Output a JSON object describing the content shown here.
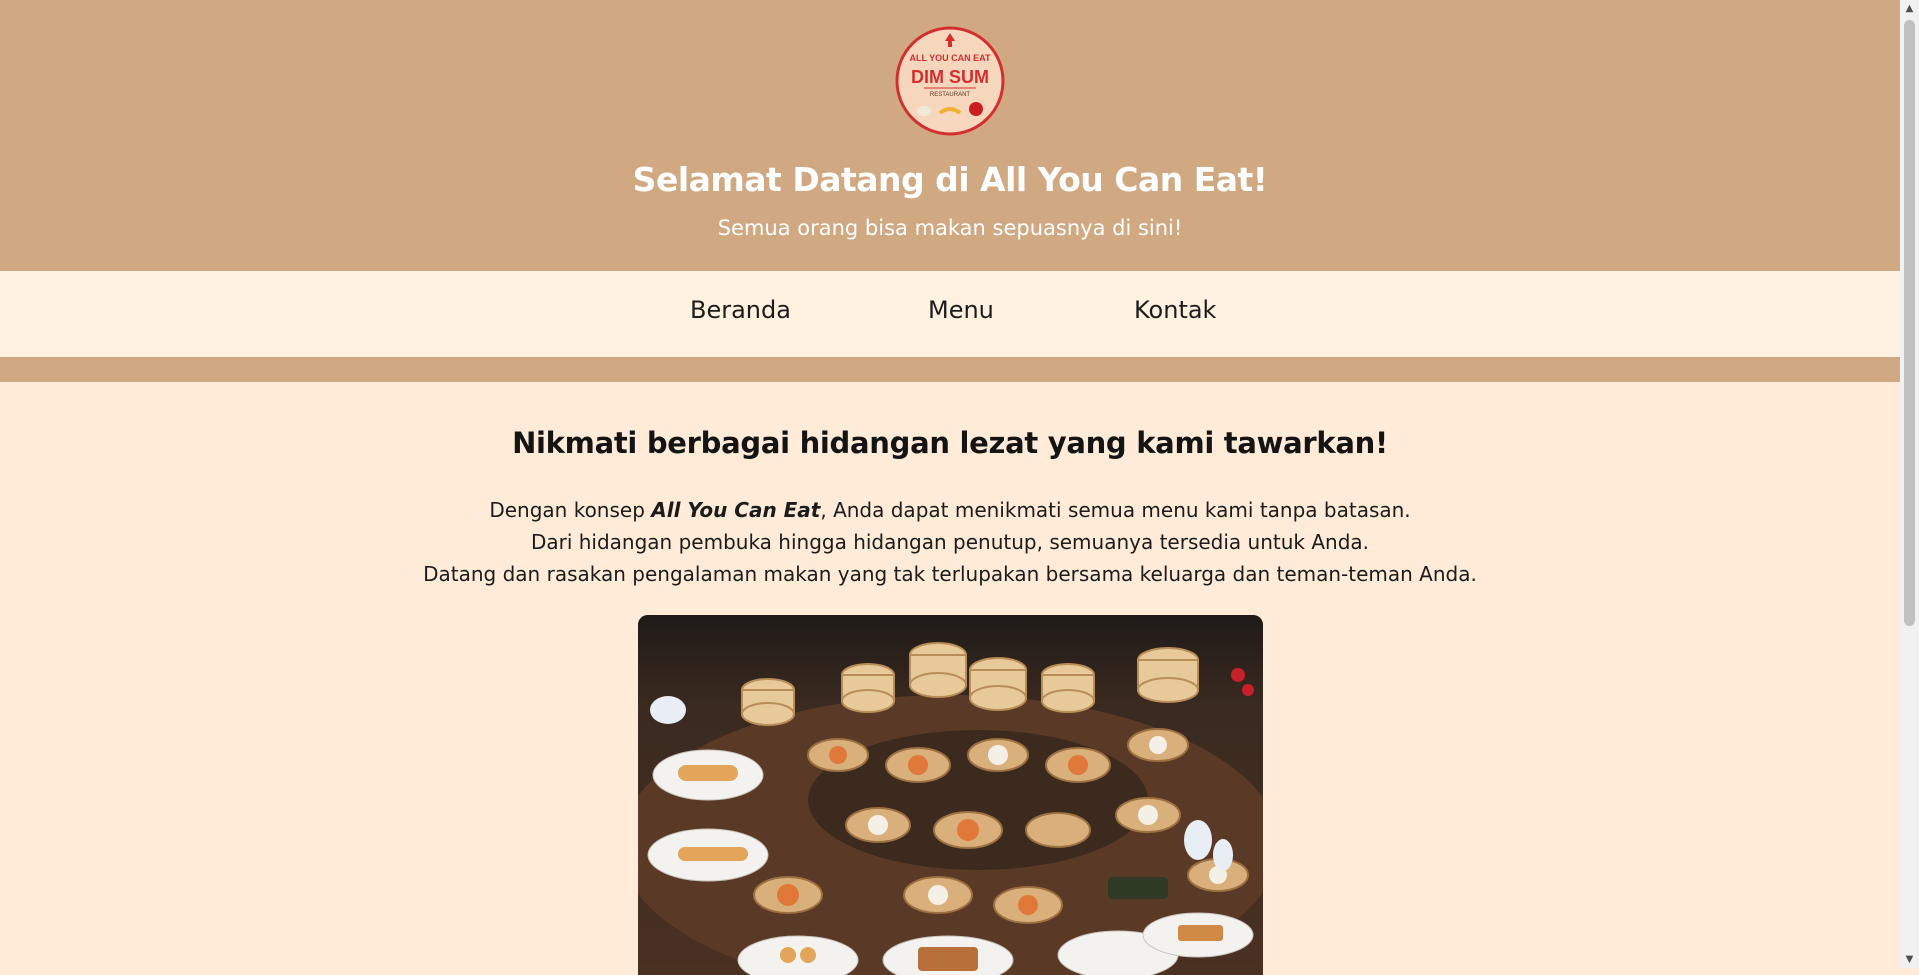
{
  "header": {
    "logo_top_text": "ALL YOU CAN EAT",
    "logo_main_text": "DIM SUM",
    "logo_bottom_text": "RESTAURANT",
    "title": "Selamat Datang di All You Can Eat!",
    "subtitle": "Semua orang bisa makan sepuasnya di sini!"
  },
  "nav": {
    "items": [
      {
        "label": "Beranda"
      },
      {
        "label": "Menu"
      },
      {
        "label": "Kontak"
      }
    ]
  },
  "main": {
    "headline": "Nikmati berbagai hidangan lezat yang kami tawarkan!",
    "intro": {
      "line1_prefix": "Dengan konsep ",
      "line1_emphasis": "All You Can Eat",
      "line1_suffix": ", Anda dapat menikmati semua menu kami tanpa batasan.",
      "line2": "Dari hidangan pembuka hingga hidangan penutup, semuanya tersedia untuk Anda.",
      "line3": "Datang dan rasakan pengalaman makan yang tak terlupakan bersama keluarga dan teman-teman Anda."
    }
  },
  "colors": {
    "header_bg": "#d0a982",
    "nav_bg": "#fff1e0",
    "page_bg": "#ffebd7",
    "logo_red": "#d32f2f"
  },
  "icons": {
    "scroll_up": "scroll-up-arrow-icon",
    "scroll_down": "scroll-down-arrow-icon",
    "logo": "dim-sum-logo"
  }
}
